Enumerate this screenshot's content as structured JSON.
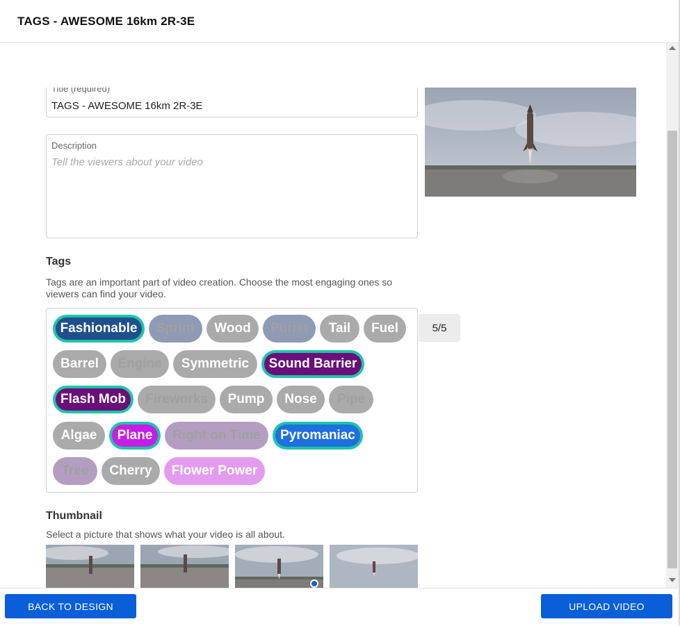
{
  "header": {
    "title": "TAGS - AWESOME 16km 2R-3E"
  },
  "form": {
    "title_label": "Title (required)",
    "title_value": "TAGS - AWESOME 16km 2R-3E",
    "description_label": "Description",
    "description_placeholder": "Tell the viewers about your video"
  },
  "tags_section": {
    "heading": "Tags",
    "help_line1": "Tags are an important part of video creation. Choose the most engaging ones so",
    "help_line2": "viewers can find your video.",
    "count": "5/5",
    "tags": [
      {
        "label": "Fashionable",
        "selected": true,
        "color": "#1f4f8c"
      },
      {
        "label": "Sprint",
        "selected": false,
        "color": "#8f9ab5"
      },
      {
        "label": "Wood",
        "selected": false,
        "color": "#aaaaaa"
      },
      {
        "label": "Purist",
        "selected": false,
        "color": "#8f9ab5"
      },
      {
        "label": "Tail",
        "selected": false,
        "color": "#aaaaaa"
      },
      {
        "label": "Fuel",
        "selected": false,
        "color": "#aaaaaa"
      },
      {
        "label": "Barrel",
        "selected": false,
        "color": "#aaaaaa"
      },
      {
        "label": "Engine",
        "selected": false,
        "color": "#aaaaaa"
      },
      {
        "label": "Symmetric",
        "selected": false,
        "color": "#aaaaaa"
      },
      {
        "label": "Sound Barrier",
        "selected": true,
        "color": "#6a0f7a"
      },
      {
        "label": "Flash Mob",
        "selected": true,
        "color": "#6a0f7a"
      },
      {
        "label": "Fireworks",
        "selected": false,
        "color": "#aaaaaa"
      },
      {
        "label": "Pump",
        "selected": false,
        "color": "#aaaaaa"
      },
      {
        "label": "Nose",
        "selected": false,
        "color": "#aaaaaa"
      },
      {
        "label": "Pipe",
        "selected": false,
        "color": "#aaaaaa"
      },
      {
        "label": "Algae",
        "selected": false,
        "color": "#aaaaaa"
      },
      {
        "label": "Plane",
        "selected": true,
        "color": "#c61ee6"
      },
      {
        "label": "Right on Time",
        "selected": false,
        "color": "#b39ec2"
      },
      {
        "label": "Pyromaniac",
        "selected": true,
        "color": "#1f6fe0"
      },
      {
        "label": "Tree",
        "selected": false,
        "color": "#b39ec2"
      },
      {
        "label": "Cherry",
        "selected": false,
        "color": "#aaaaaa"
      },
      {
        "label": "Flower Power",
        "selected": false,
        "color": "#e39bf0"
      }
    ]
  },
  "thumbnail_section": {
    "heading": "Thumbnail",
    "help": "Select a picture that shows what your video is all about."
  },
  "footer": {
    "back_label": "BACK TO DESIGN",
    "upload_label": "UPLOAD VIDEO"
  },
  "colors": {
    "accent": "#0a5fd8",
    "selected_ring": "#1ec5a8"
  }
}
